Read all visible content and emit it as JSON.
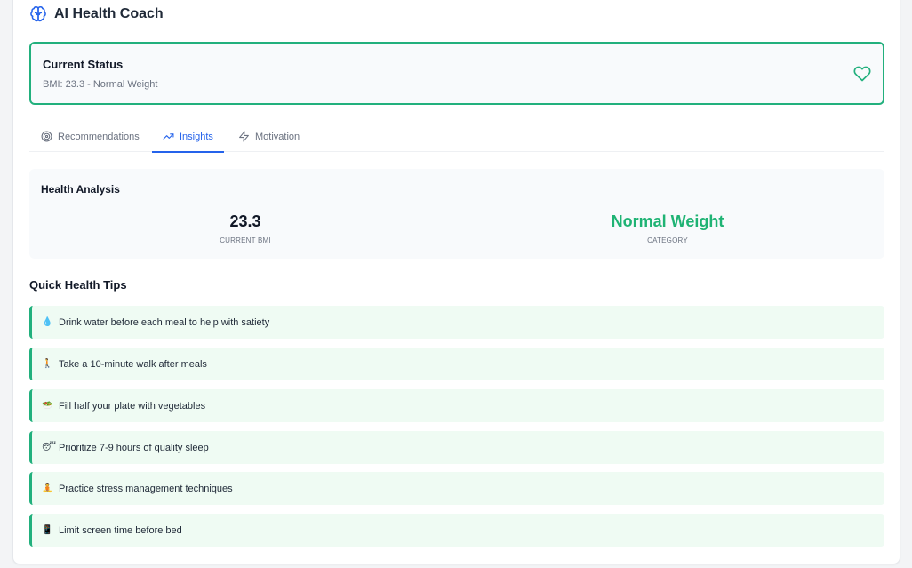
{
  "header": {
    "title": "AI Health Coach",
    "icon": "brain-icon"
  },
  "status": {
    "title": "Current Status",
    "subtitle": "BMI: 23.3 - Normal Weight",
    "icon": "heart-icon"
  },
  "tabs": [
    {
      "label": "Recommendations",
      "icon": "target-icon",
      "active": false
    },
    {
      "label": "Insights",
      "icon": "trending-up-icon",
      "active": true
    },
    {
      "label": "Motivation",
      "icon": "zap-icon",
      "active": false
    }
  ],
  "analysis": {
    "title": "Health Analysis",
    "bmi_value": "23.3",
    "bmi_label": "CURRENT BMI",
    "category_value": "Normal Weight",
    "category_label": "CATEGORY"
  },
  "tips": {
    "title": "Quick Health Tips",
    "items": [
      {
        "emoji": "💧",
        "text": "Drink water before each meal to help with satiety"
      },
      {
        "emoji": "🚶",
        "text": "Take a 10-minute walk after meals"
      },
      {
        "emoji": "🥗",
        "text": "Fill half your plate with vegetables"
      },
      {
        "emoji": "😴",
        "text": "Prioritize 7-9 hours of quality sleep"
      },
      {
        "emoji": "🧘",
        "text": "Practice stress management techniques"
      },
      {
        "emoji": "📱",
        "text": "Limit screen time before bed"
      }
    ]
  },
  "colors": {
    "accent_green": "#22b07d",
    "category_green": "#1fb374",
    "tab_active_blue": "#2563eb",
    "tip_background": "#effbf3"
  }
}
